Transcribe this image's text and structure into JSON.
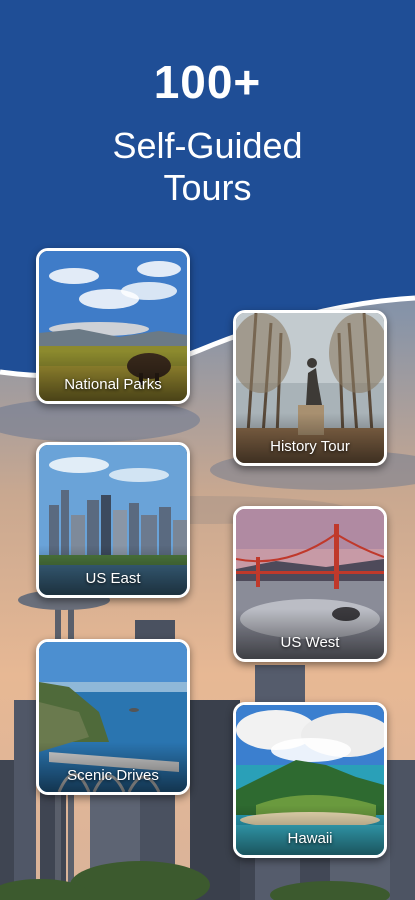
{
  "headline": {
    "count": "100+",
    "line1": "Self-Guided",
    "line2": "Tours"
  },
  "colors": {
    "brand_blue": "#1f4e96"
  },
  "tours": [
    {
      "label": "National Parks"
    },
    {
      "label": "History Tour"
    },
    {
      "label": "US East"
    },
    {
      "label": "US West"
    },
    {
      "label": "Scenic Drives"
    },
    {
      "label": "Hawaii"
    }
  ]
}
